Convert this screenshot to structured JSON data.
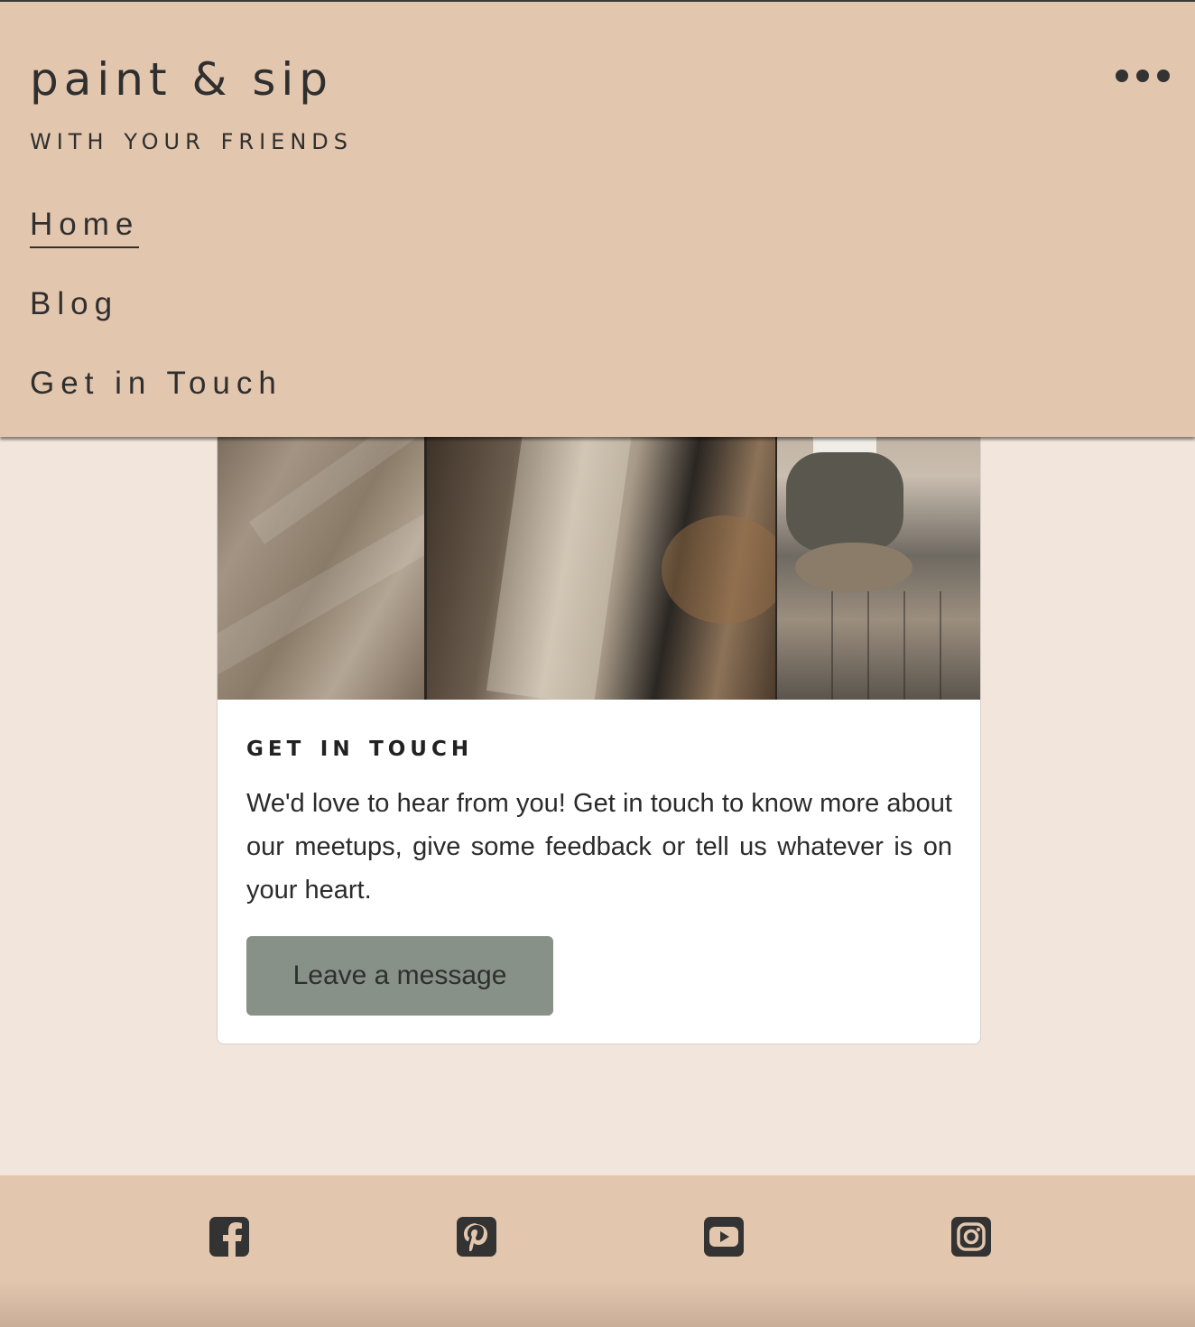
{
  "header": {
    "title": "paint & sip",
    "subtitle": "with your friends",
    "menu_icon": "ellipsis-icon"
  },
  "nav": {
    "items": [
      {
        "label": "Home",
        "active": true
      },
      {
        "label": "Blog",
        "active": false
      },
      {
        "label": "Get in Touch",
        "active": false
      }
    ]
  },
  "card": {
    "image": "collage of neutral-toned sweater, knit fabric and woman sitting on cushion",
    "title": "get in touch",
    "text": "We'd love to hear from you! Get in touch to know more about our meetups, give some feedback or tell us whatever is on your heart.",
    "button_label": "Leave a message"
  },
  "footer": {
    "social": [
      {
        "icon": "facebook-icon"
      },
      {
        "icon": "pinterest-icon"
      },
      {
        "icon": "youtube-icon"
      },
      {
        "icon": "instagram-icon"
      }
    ]
  },
  "colors": {
    "header_bg": "#e3c6ae",
    "page_bg": "#f2e5dc",
    "button_bg": "#879187",
    "text": "#2b2b2b"
  }
}
